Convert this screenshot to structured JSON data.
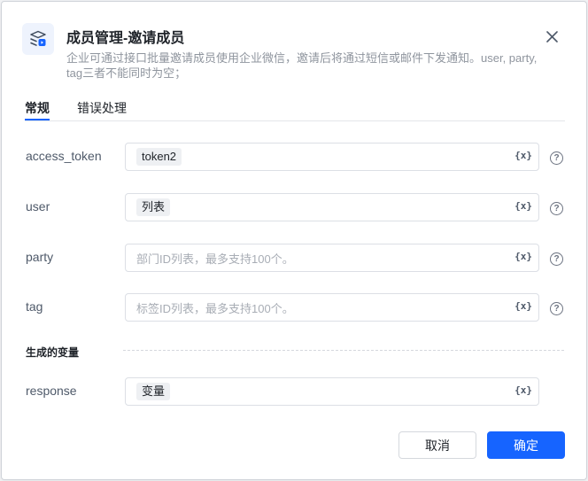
{
  "dialog": {
    "title": "成员管理-邀请成员",
    "description": "企业可通过接口批量邀请成员使用企业微信，邀请后将通过短信或邮件下发通知。user, party, tag三者不能同时为空；",
    "icon": "api-module-icon",
    "accent_color": "#1664ff"
  },
  "tabs": [
    {
      "label": "常规",
      "active": true
    },
    {
      "label": "错误处理",
      "active": false
    }
  ],
  "fields": [
    {
      "label": "access_token",
      "value": "token2",
      "placeholder": ""
    },
    {
      "label": "user",
      "value": "列表",
      "placeholder": ""
    },
    {
      "label": "party",
      "value": "",
      "placeholder": "部门ID列表，最多支持100个。"
    },
    {
      "label": "tag",
      "value": "",
      "placeholder": "标签ID列表，最多支持100个。"
    }
  ],
  "variable_button_label": "{x}",
  "help_icon_label": "?",
  "output_section": {
    "title": "生成的变量",
    "field": {
      "label": "response",
      "value": "变量"
    }
  },
  "footer": {
    "cancel_label": "取消",
    "confirm_label": "确定"
  }
}
